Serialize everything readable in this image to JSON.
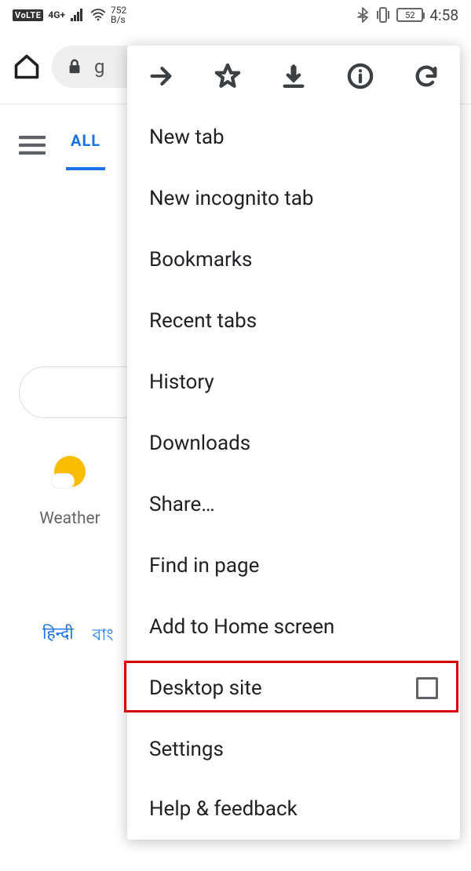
{
  "status": {
    "volte": "VoLTE",
    "net": "4G+",
    "bytes_top": "752",
    "bytes_bottom": "B/s",
    "battery": "52",
    "time": "4:58"
  },
  "toolbar": {
    "omnibox_text": "g"
  },
  "page": {
    "tab_all": "ALL",
    "weather_label": "Weather",
    "lang1": "हिन्दी",
    "lang2": "বাং"
  },
  "menu": {
    "new_tab": "New tab",
    "incognito": "New incognito tab",
    "bookmarks": "Bookmarks",
    "recent": "Recent tabs",
    "history": "History",
    "downloads": "Downloads",
    "share": "Share…",
    "find": "Find in page",
    "a2hs": "Add to Home screen",
    "desktop": "Desktop site",
    "settings": "Settings",
    "help": "Help & feedback"
  }
}
